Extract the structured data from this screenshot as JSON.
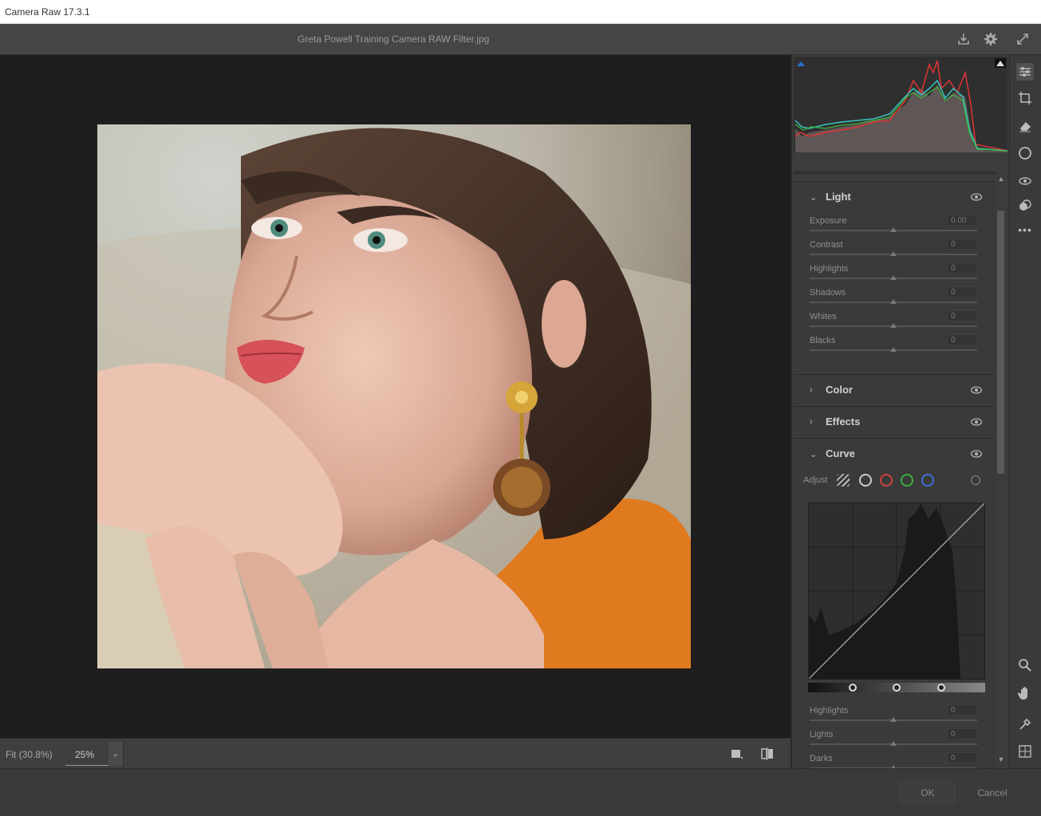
{
  "window": {
    "title": "Camera Raw 17.3.1"
  },
  "document": {
    "filename": "Greta Powell Training Camera RAW Filter.jpg"
  },
  "header_icons": [
    "save-icon",
    "gear-icon",
    "fullscreen-icon"
  ],
  "histogram": {
    "clip_shadow_color": "#2a6fd6",
    "clip_highlight_color": "#e0e0e0"
  },
  "sections": {
    "light": {
      "label": "Light",
      "expanded": true,
      "sliders": [
        {
          "label": "Exposure",
          "value": "0.00"
        },
        {
          "label": "Contrast",
          "value": "0"
        },
        {
          "label": "Highlights",
          "value": "0"
        },
        {
          "label": "Shadows",
          "value": "0"
        },
        {
          "label": "Whites",
          "value": "0"
        },
        {
          "label": "Blacks",
          "value": "0"
        }
      ]
    },
    "color": {
      "label": "Color",
      "expanded": false
    },
    "effects": {
      "label": "Effects",
      "expanded": false
    },
    "curve": {
      "label": "Curve",
      "expanded": true,
      "adjust_label": "Adjust",
      "channel_colors": [
        "#cccccc",
        "#d04040",
        "#3fae3f",
        "#3f6fd6"
      ],
      "sliders": [
        {
          "label": "Highlights",
          "value": "0"
        },
        {
          "label": "Lights",
          "value": "0"
        },
        {
          "label": "Darks",
          "value": "0"
        }
      ]
    }
  },
  "bottom_bar": {
    "fit_label": "Fit (30.8%)",
    "zoom_value": "25%"
  },
  "footer": {
    "ok_label": "OK",
    "cancel_label": "Cancel"
  },
  "tools": [
    "edit-sliders-icon",
    "crop-icon",
    "eraser-icon",
    "mask-icon",
    "redeye-icon",
    "presets-icon",
    "more-icon",
    "zoom-icon",
    "hand-icon",
    "sampler-icon",
    "grid-icon"
  ]
}
